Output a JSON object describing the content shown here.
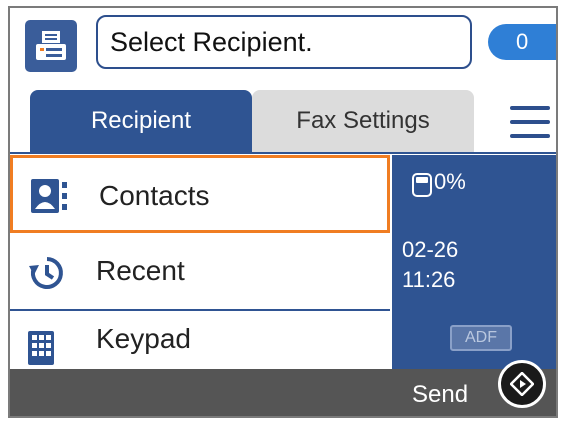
{
  "header": {
    "recipient_prompt": "Select Recipient.",
    "recipient_count": "0",
    "fax_icon": "fax-machine-icon"
  },
  "tabs": [
    {
      "label": "Recipient",
      "active": true
    },
    {
      "label": "Fax Settings",
      "active": false
    }
  ],
  "menu_icon": "hamburger-menu-icon",
  "list": [
    {
      "label": "Contacts",
      "icon": "contacts-icon",
      "selected": true
    },
    {
      "label": "Recent",
      "icon": "recent-history-icon",
      "selected": false
    },
    {
      "label": "Keypad",
      "icon": "keypad-icon",
      "selected": false
    }
  ],
  "status": {
    "memory": "0%",
    "date": "02-26",
    "time": "11:26",
    "adf": "ADF"
  },
  "footer": {
    "send_label": "Send",
    "start_icon": "start-diamond-icon"
  },
  "colors": {
    "primary": "#2f5492",
    "selection": "#f07d22",
    "badge": "#2f7fd6",
    "bottom_bar": "#555555"
  }
}
